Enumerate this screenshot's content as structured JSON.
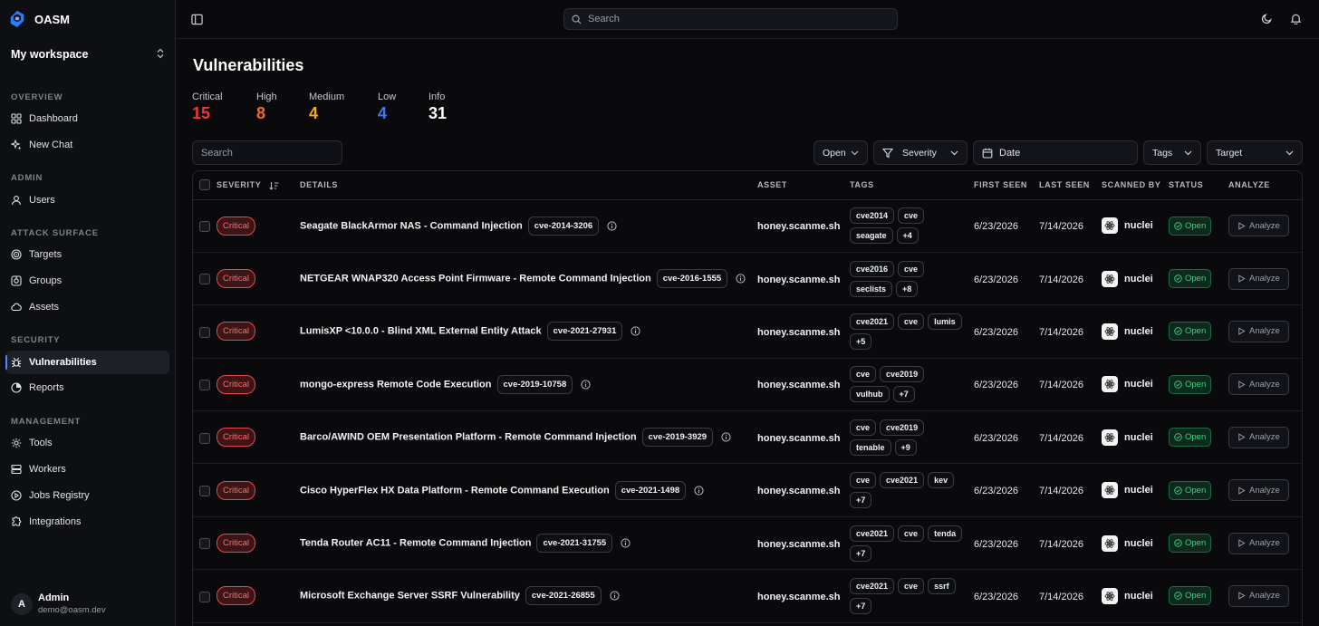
{
  "app": {
    "name": "OASM",
    "brand_color": "#2f7df6"
  },
  "workspace": {
    "label": "My workspace"
  },
  "sidebar": {
    "sections": [
      {
        "title": "OVERVIEW",
        "items": [
          {
            "label": "Dashboard",
            "icon": "dashboard-icon"
          },
          {
            "label": "New Chat",
            "icon": "sparkles-icon"
          }
        ]
      },
      {
        "title": "ADMIN",
        "items": [
          {
            "label": "Users",
            "icon": "user-icon"
          }
        ]
      },
      {
        "title": "ATTACK SURFACE",
        "items": [
          {
            "label": "Targets",
            "icon": "target-icon"
          },
          {
            "label": "Groups",
            "icon": "groups-icon"
          },
          {
            "label": "Assets",
            "icon": "assets-icon"
          }
        ]
      },
      {
        "title": "SECURITY",
        "items": [
          {
            "label": "Vulnerabilities",
            "icon": "bug-icon",
            "active": true
          },
          {
            "label": "Reports",
            "icon": "reports-icon"
          }
        ]
      },
      {
        "title": "MANAGEMENT",
        "items": [
          {
            "label": "Tools",
            "icon": "tools-icon"
          },
          {
            "label": "Workers",
            "icon": "workers-icon"
          },
          {
            "label": "Jobs Registry",
            "icon": "jobs-icon"
          },
          {
            "label": "Integrations",
            "icon": "integrations-icon"
          }
        ]
      }
    ]
  },
  "user": {
    "initial": "A",
    "name": "Admin",
    "email": "demo@oasm.dev"
  },
  "topbar": {
    "search_placeholder": "Search"
  },
  "page": {
    "title": "Vulnerabilities"
  },
  "stats": [
    {
      "label": "Critical",
      "value": "15",
      "color": "#f0353b"
    },
    {
      "label": "High",
      "value": "8",
      "color": "#f46a28"
    },
    {
      "label": "Medium",
      "value": "4",
      "color": "#f3a81a"
    },
    {
      "label": "Low",
      "value": "4",
      "color": "#3a7cf0"
    },
    {
      "label": "Info",
      "value": "31",
      "color": "#ffffff"
    }
  ],
  "filters": {
    "search_placeholder": "Search",
    "status": "Open",
    "severity": "Severity",
    "date": "Date",
    "tags": "Tags",
    "target": "Target"
  },
  "table": {
    "columns": {
      "severity": "SEVERITY",
      "details": "DETAILS",
      "asset": "ASSET",
      "tags": "TAGS",
      "first_seen": "FIRST SEEN",
      "last_seen": "LAST SEEN",
      "scanned_by": "SCANNED BY",
      "status": "STATUS",
      "analyze": "ANALYZE"
    },
    "rows": [
      {
        "severity": "Critical",
        "name": "Seagate BlackArmor NAS - Command Injection",
        "cve": "cve-2014-3206",
        "asset": "honey.scanme.sh",
        "tags": [
          "cve2014",
          "cve",
          "seagate",
          "+4"
        ],
        "first_seen": "6/23/2026",
        "last_seen": "7/14/2026",
        "scanner": "nuclei",
        "status": "Open",
        "action": "Analyze"
      },
      {
        "severity": "Critical",
        "name": "NETGEAR WNAP320 Access Point Firmware - Remote Command Injection",
        "cve": "cve-2016-1555",
        "asset": "honey.scanme.sh",
        "tags": [
          "cve2016",
          "cve",
          "seclists",
          "+8"
        ],
        "first_seen": "6/23/2026",
        "last_seen": "7/14/2026",
        "scanner": "nuclei",
        "status": "Open",
        "action": "Analyze"
      },
      {
        "severity": "Critical",
        "name": "LumisXP <10.0.0 - Blind XML External Entity Attack",
        "cve": "cve-2021-27931",
        "asset": "honey.scanme.sh",
        "tags": [
          "cve2021",
          "cve",
          "lumis",
          "+5"
        ],
        "first_seen": "6/23/2026",
        "last_seen": "7/14/2026",
        "scanner": "nuclei",
        "status": "Open",
        "action": "Analyze"
      },
      {
        "severity": "Critical",
        "name": "mongo-express Remote Code Execution",
        "cve": "cve-2019-10758",
        "asset": "honey.scanme.sh",
        "tags": [
          "cve",
          "cve2019",
          "vulhub",
          "+7"
        ],
        "first_seen": "6/23/2026",
        "last_seen": "7/14/2026",
        "scanner": "nuclei",
        "status": "Open",
        "action": "Analyze"
      },
      {
        "severity": "Critical",
        "name": "Barco/AWIND OEM Presentation Platform - Remote Command Injection",
        "cve": "cve-2019-3929",
        "asset": "honey.scanme.sh",
        "tags": [
          "cve",
          "cve2019",
          "tenable",
          "+9"
        ],
        "first_seen": "6/23/2026",
        "last_seen": "7/14/2026",
        "scanner": "nuclei",
        "status": "Open",
        "action": "Analyze"
      },
      {
        "severity": "Critical",
        "name": "Cisco HyperFlex HX Data Platform - Remote Command Execution",
        "cve": "cve-2021-1498",
        "asset": "honey.scanme.sh",
        "tags": [
          "cve",
          "cve2021",
          "kev",
          "+7"
        ],
        "first_seen": "6/23/2026",
        "last_seen": "7/14/2026",
        "scanner": "nuclei",
        "status": "Open",
        "action": "Analyze"
      },
      {
        "severity": "Critical",
        "name": "Tenda Router AC11 - Remote Command Injection",
        "cve": "cve-2021-31755",
        "asset": "honey.scanme.sh",
        "tags": [
          "cve2021",
          "cve",
          "tenda",
          "+7"
        ],
        "first_seen": "6/23/2026",
        "last_seen": "7/14/2026",
        "scanner": "nuclei",
        "status": "Open",
        "action": "Analyze"
      },
      {
        "severity": "Critical",
        "name": "Microsoft Exchange Server SSRF Vulnerability",
        "cve": "cve-2021-26855",
        "asset": "honey.scanme.sh",
        "tags": [
          "cve2021",
          "cve",
          "ssrf",
          "+7"
        ],
        "first_seen": "6/23/2026",
        "last_seen": "7/14/2026",
        "scanner": "nuclei",
        "status": "Open",
        "action": "Analyze"
      }
    ]
  }
}
